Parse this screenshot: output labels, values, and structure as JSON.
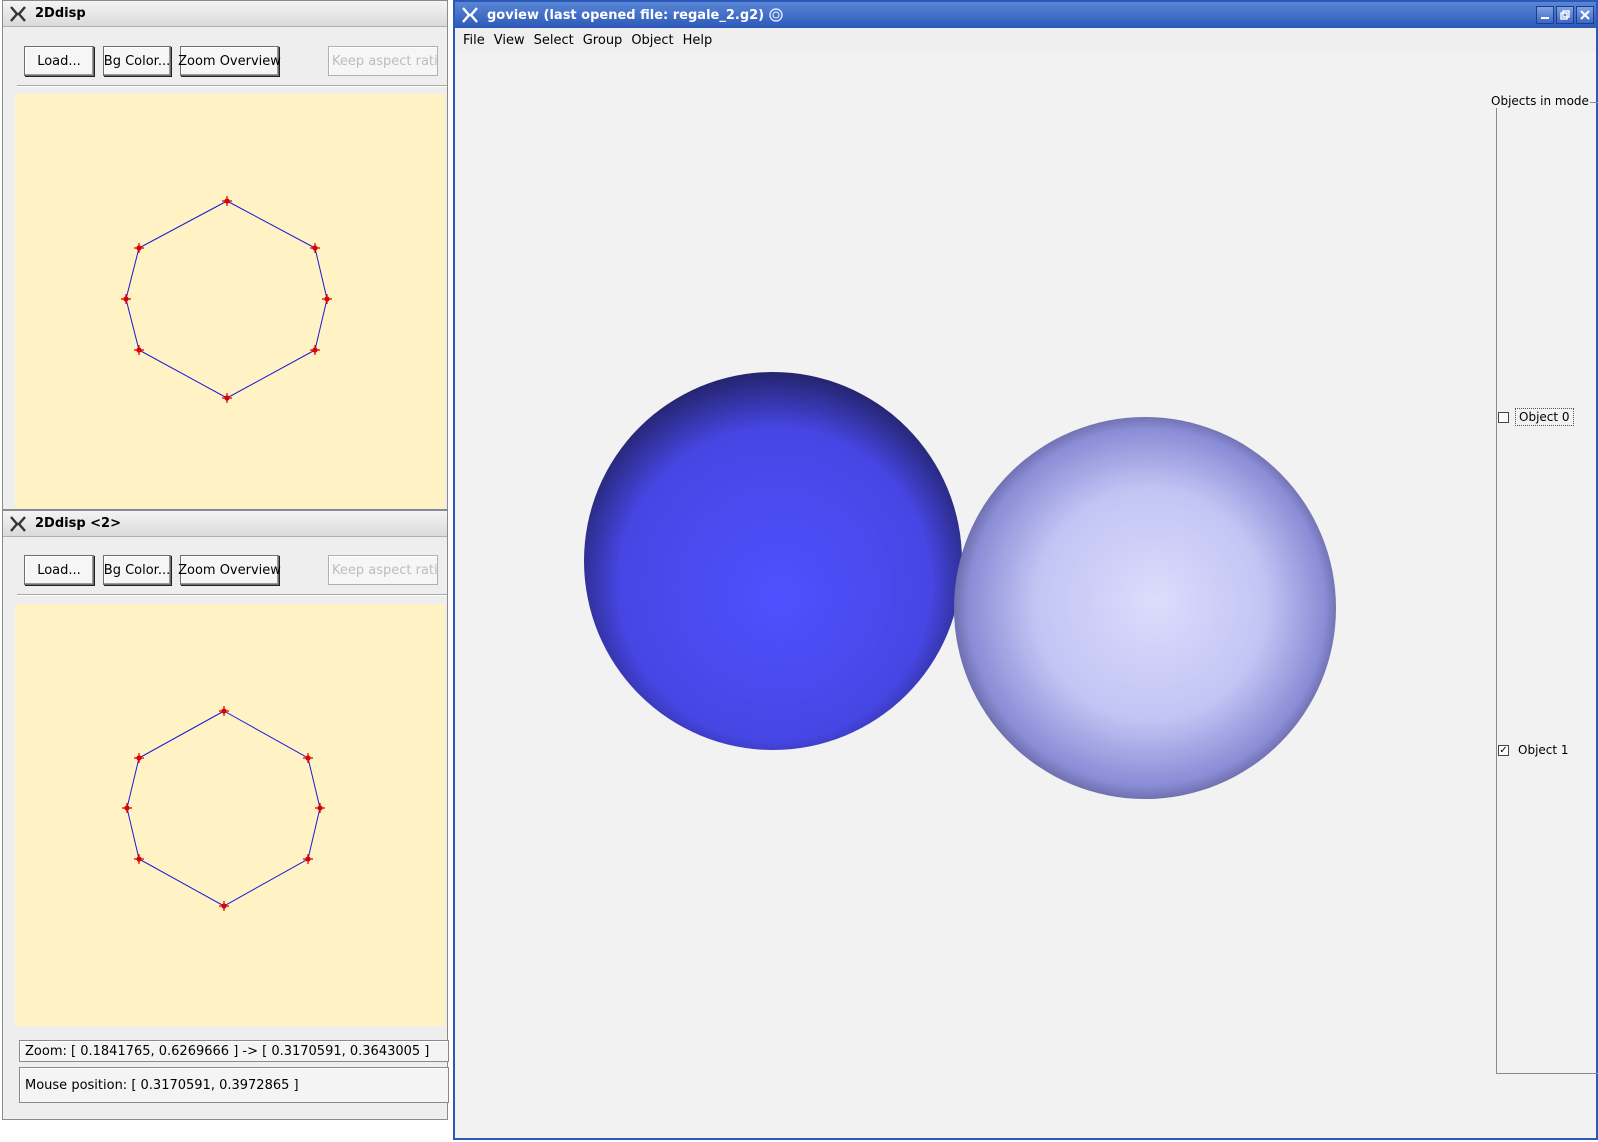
{
  "win_a": {
    "title": "2Ddisp",
    "buttons": {
      "load": "Load...",
      "bg_color": "Bg Color...",
      "zoom_overview": "Zoom Overview",
      "keep_aspect": "Keep aspect ratio"
    }
  },
  "win_b": {
    "title": "2Ddisp <2>",
    "buttons": {
      "load": "Load...",
      "bg_color": "Bg Color...",
      "zoom_overview": "Zoom Overview",
      "keep_aspect": "Keep aspect ratio"
    },
    "status": {
      "zoom": "Zoom: [ 0.1841765, 0.6269666 ] -> [ 0.3170591, 0.3643005 ]",
      "mouse": "Mouse position: [ 0.3170591, 0.3972865 ]"
    }
  },
  "goview": {
    "title": "goview (last opened file: regale_2.g2)",
    "menu": [
      "File",
      "View",
      "Select",
      "Group",
      "Object",
      "Help"
    ],
    "panel_title": "Objects in mode",
    "objects": [
      {
        "label": "Object 0",
        "checked": false
      },
      {
        "label": "Object 1",
        "checked": true
      }
    ]
  },
  "colors": {
    "canvas_bg": "#fff2c4",
    "curve_line": "#1a1ad6",
    "control_point": "#e00000",
    "sphere_0": "#4a4ae8",
    "sphere_1": "#c8caf6",
    "active_title": "#2c59b8"
  },
  "icons": [
    "x-logo-icon",
    "minimize-icon",
    "maximize-icon",
    "close-icon",
    "spiral-icon",
    "check-icon"
  ]
}
